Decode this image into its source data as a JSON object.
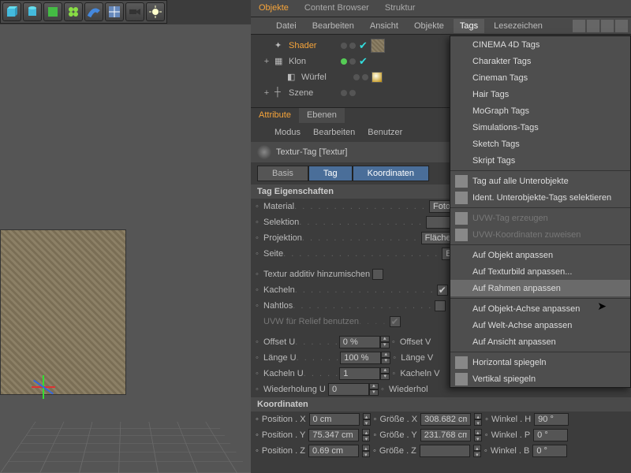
{
  "toolbar_icons": [
    "cube",
    "cylinder",
    "extrude",
    "array",
    "sweep",
    "floor",
    "camera",
    "light"
  ],
  "object_panel": {
    "tabs": [
      "Objekte",
      "Content Browser",
      "Struktur"
    ],
    "active_tab": 0,
    "menus": [
      "Datei",
      "Bearbeiten",
      "Ansicht",
      "Objekte",
      "Tags",
      "Lesezeichen"
    ],
    "active_menu": 4,
    "search_icons": [
      "search",
      "eye",
      "funnel",
      "plus"
    ],
    "tree": [
      {
        "name": "Shader",
        "selected": true,
        "icon": "shader",
        "tag": "texture"
      },
      {
        "name": "Klon",
        "selected": false,
        "icon": "clone",
        "expand": "+"
      },
      {
        "name": "Würfel",
        "selected": false,
        "icon": "cube",
        "tag": "orange"
      },
      {
        "name": "Szene",
        "selected": false,
        "icon": "null",
        "expand": "+"
      }
    ]
  },
  "attribute_panel": {
    "tabs": [
      "Attribute",
      "Ebenen"
    ],
    "active_tab": 0,
    "submenus": [
      "Modus",
      "Bearbeiten",
      "Benutzer"
    ],
    "title": "Textur-Tag [Textur]",
    "mode_tabs": [
      "Basis",
      "Tag",
      "Koordinaten"
    ],
    "active_mode": 1,
    "section1": "Tag Eigenschaften",
    "props": {
      "material_lbl": "Material",
      "material_val": "Foto",
      "selektion_lbl": "Selektion",
      "selektion_val": "",
      "projektion_lbl": "Projektion",
      "projektion_val": "Fläche-Mapp",
      "seite_lbl": "Seite",
      "seite_val": "Beide",
      "additiv_lbl": "Textur additiv hinzumischen",
      "kacheln_lbl": "Kacheln",
      "nahtlos_lbl": "Nahtlos",
      "uvw_lbl": "UVW für Relief benutzen",
      "offsetu_lbl": "Offset U",
      "offsetu_val": "0 %",
      "offsetv_lbl": "Offset V",
      "laengeu_lbl": "Länge U",
      "laengeu_val": "100 %",
      "laengev_lbl": "Länge V",
      "kachelnu_lbl": "Kacheln U",
      "kachelnu_val": "1",
      "kachelnv_lbl": "Kacheln V",
      "wiedu_lbl": "Wiederholung U",
      "wiedu_val": "0",
      "wiedv_lbl": "Wiederhol"
    },
    "section2": "Koordinaten",
    "coords": {
      "px_lbl": "Position . X",
      "px": "0 cm",
      "gx_lbl": "Größe . X",
      "gx": "308.682 cm",
      "wh_lbl": "Winkel . H",
      "wh": "90 °",
      "py_lbl": "Position . Y",
      "py": "75.347 cm",
      "gy_lbl": "Größe . Y",
      "gy": "231.768 cm",
      "wp_lbl": "Winkel . P",
      "wp": "0 °",
      "pz_lbl": "Position . Z",
      "pz": "0.69 cm",
      "gz_lbl": "Größe . Z",
      "wb_lbl": "Winkel . B",
      "wb": "0 °"
    }
  },
  "tags_menu": {
    "groups": [
      [
        "CINEMA 4D Tags",
        "Charakter Tags",
        "Cineman Tags",
        "Hair Tags",
        "MoGraph Tags",
        "Simulations-Tags",
        "Sketch Tags",
        "Skript Tags"
      ],
      [
        "Tag auf alle Unterobjekte",
        "Ident. Unterobjekte-Tags selektieren"
      ],
      [
        "UVW-Tag erzeugen",
        "UVW-Koordinaten zuweisen"
      ],
      [
        "Auf Objekt anpassen",
        "Auf Texturbild anpassen...",
        "Auf Rahmen anpassen"
      ],
      [
        "Auf Objekt-Achse anpassen",
        "Auf Welt-Achse anpassen",
        "Auf Ansicht anpassen"
      ],
      [
        "Horizontal spiegeln",
        "Vertikal spiegeln"
      ]
    ],
    "dim_group": 2,
    "hover": "Auf Rahmen anpassen",
    "icon_items": {
      "Tag auf alle Unterobjekte": "tag",
      "Ident. Unterobjekte-Tags selektieren": "sphere",
      "UVW-Tag erzeugen": "grid",
      "UVW-Koordinaten zuweisen": "grid",
      "Horizontal spiegeln": "mirror-h",
      "Vertikal spiegeln": "mirror-v"
    }
  }
}
